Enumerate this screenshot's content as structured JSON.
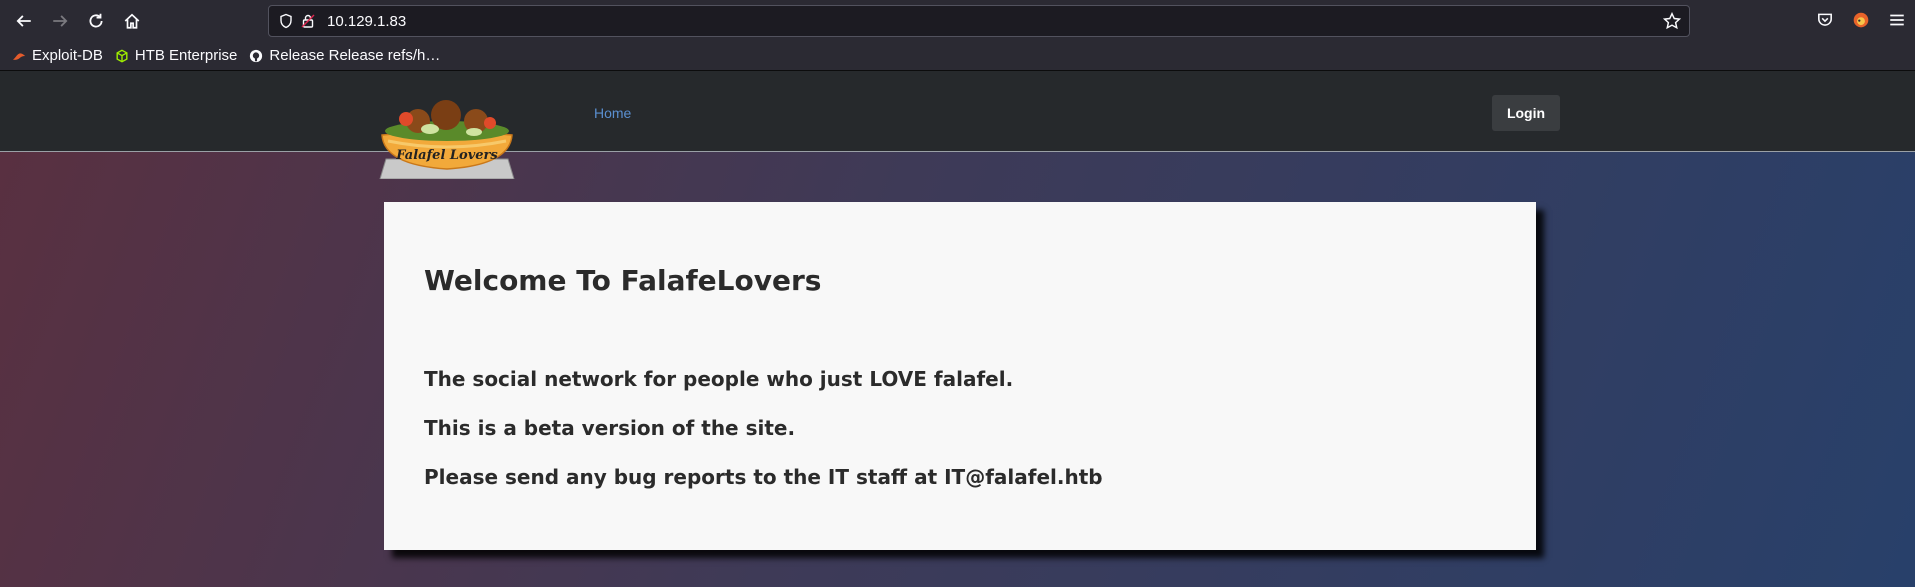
{
  "browser": {
    "url": "10.129.1.83",
    "bookmarks": [
      {
        "label": "Exploit-DB",
        "icon": "exploit-db-icon"
      },
      {
        "label": "HTB Enterprise",
        "icon": "htb-cube-icon"
      },
      {
        "label": "Release Release refs/h…",
        "icon": "github-icon"
      }
    ]
  },
  "site": {
    "logo_text": "Falafel Lovers",
    "nav": {
      "home_label": "Home",
      "login_label": "Login"
    },
    "card": {
      "title": "Welcome To FalafeLovers",
      "line1": "The social network for people who just LOVE falafel.",
      "line2": "This is a beta version of the site.",
      "line3": "Please send any bug reports to the IT staff at IT@falafel.htb"
    }
  },
  "colors": {
    "nav_bg": "#26292c",
    "link": "#5a8fd0",
    "card_bg": "#f8f8f8"
  }
}
